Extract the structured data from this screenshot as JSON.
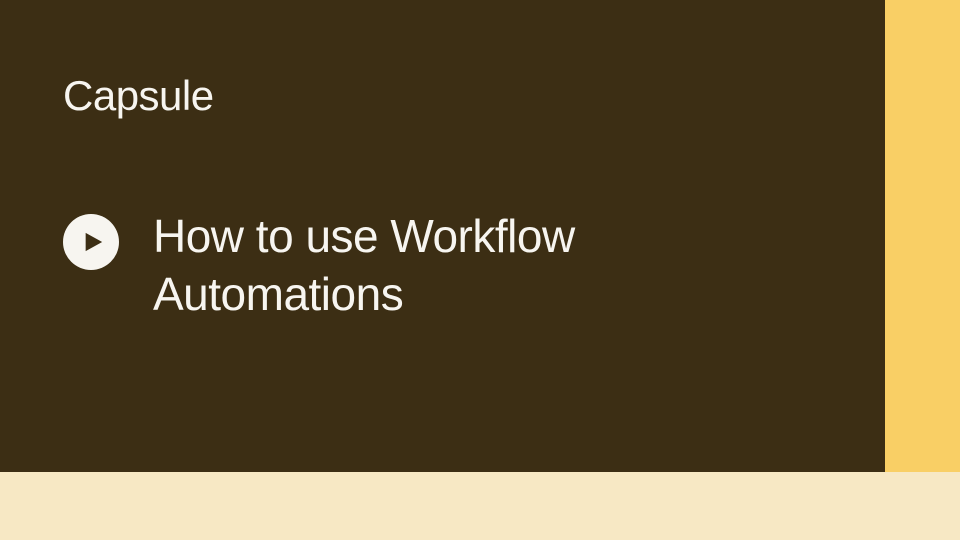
{
  "brand": "Capsule",
  "video": {
    "title": "How to use Workflow Automations"
  },
  "colors": {
    "panel_bg": "#3C2E14",
    "accent_right": "#F9CF65",
    "bottom_band": "#F7E8C4",
    "text": "#F7F5F0"
  },
  "icons": {
    "play": "play-icon"
  }
}
